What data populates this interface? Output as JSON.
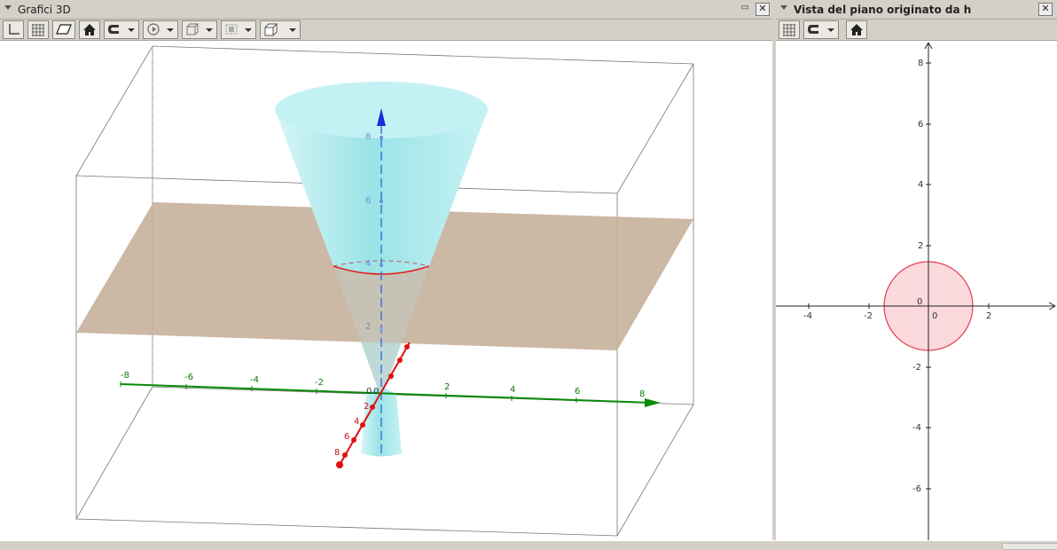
{
  "left_view": {
    "title": "Grafici 3D",
    "toolbar_icons": [
      "axes-icon",
      "grid-icon",
      "plane-icon",
      "home-icon",
      "magnet-icon",
      "rotate-icon",
      "view-direction-icon",
      "clipping-icon",
      "projection-icon"
    ],
    "x_ticks": [
      "-8",
      "-6",
      "-4",
      "-2",
      "0",
      "2",
      "4",
      "6",
      "8"
    ],
    "origin_label": "0",
    "y_ticks": [
      "2",
      "4",
      "6",
      "8"
    ],
    "z_ticks": [
      "2",
      "4",
      "6",
      "8"
    ],
    "colors": {
      "cone": "#bff0f2",
      "plane": "#c9b6a2",
      "x_axis": "#0a8a0a",
      "y_axis": "#e01010",
      "z_axis": "#1a2bd8",
      "intersection": "#e02020"
    }
  },
  "right_view": {
    "title": "Vista del piano originato da h",
    "toolbar_icons": [
      "grid-icon",
      "magnet-icon",
      "home-icon"
    ],
    "x_ticks": [
      "-4",
      "-2",
      "0",
      "2"
    ],
    "y_ticks": [
      "8",
      "6",
      "4",
      "2",
      "-2",
      "-4",
      "-6"
    ],
    "origin_label": "0",
    "colors": {
      "circle_fill": "#fbd9dc",
      "circle_stroke": "#e04050"
    }
  }
}
